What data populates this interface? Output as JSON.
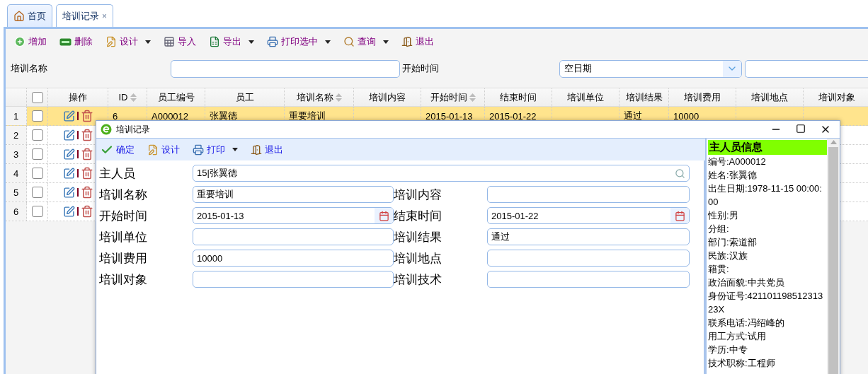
{
  "tabs": [
    {
      "label": "首页",
      "closable": false,
      "selected": false
    },
    {
      "label": "培训记录",
      "closable": true,
      "selected": true
    }
  ],
  "close_mark": "×",
  "toolbar": [
    {
      "label": "增加",
      "dropdown": false
    },
    {
      "label": "删除",
      "dropdown": false
    },
    {
      "label": "设计",
      "dropdown": true
    },
    {
      "label": "导入",
      "dropdown": false
    },
    {
      "label": "导出",
      "dropdown": true
    },
    {
      "label": "打印选中",
      "dropdown": true
    },
    {
      "label": "查询",
      "dropdown": true
    },
    {
      "label": "退出",
      "dropdown": false
    }
  ],
  "filter": {
    "label": "培训名称",
    "date_label": "开始时间",
    "date_value": "空日期"
  },
  "grid": {
    "all_checked": false,
    "columns": [
      {
        "label": "操作",
        "sortable": false
      },
      {
        "label": "ID",
        "sortable": true
      },
      {
        "label": "员工编号",
        "sortable": false
      },
      {
        "label": "员工",
        "sortable": false
      },
      {
        "label": "培训名称",
        "sortable": true
      },
      {
        "label": "培训内容",
        "sortable": false
      },
      {
        "label": "开始时间",
        "sortable": true
      },
      {
        "label": "结束时间",
        "sortable": false
      },
      {
        "label": "培训单位",
        "sortable": false
      },
      {
        "label": "培训结果",
        "sortable": false
      },
      {
        "label": "培训费用",
        "sortable": false
      },
      {
        "label": "培训地点",
        "sortable": false
      },
      {
        "label": "培训对象",
        "sortable": false
      }
    ],
    "rows": [
      {
        "number": "1",
        "selected": true,
        "checked": false,
        "cells": [
          "6",
          "A000012",
          "张翼德",
          "重要培训",
          null,
          "2015-01-13",
          "2015-01-22",
          null,
          "通过",
          "10000",
          null,
          null
        ]
      },
      {
        "number": "2",
        "selected": false,
        "checked": false
      },
      {
        "number": "3",
        "selected": false,
        "checked": false
      },
      {
        "number": "4",
        "selected": false,
        "checked": false
      },
      {
        "number": "5",
        "selected": false,
        "checked": false
      },
      {
        "number": "6",
        "selected": false,
        "checked": false
      }
    ]
  },
  "dialog": {
    "title": "培训记录",
    "toolbar": [
      {
        "label": "确定",
        "dropdown": false
      },
      {
        "label": "设计",
        "dropdown": false
      },
      {
        "label": "打印",
        "dropdown": true
      },
      {
        "label": "退出",
        "dropdown": false
      }
    ],
    "fields": [
      {
        "label": "主人员",
        "value": "15|张翼德",
        "kind": "lookup"
      },
      {
        "label": "培训名称",
        "value": "重要培训",
        "kind": "text"
      },
      {
        "label": "培训内容",
        "kind": "text"
      },
      {
        "label": "开始时间",
        "value": "2015-01-13",
        "kind": "date"
      },
      {
        "label": "结束时间",
        "value": "2015-01-22",
        "kind": "date"
      },
      {
        "label": "培训单位",
        "kind": "text"
      },
      {
        "label": "培训结果",
        "value": "通过",
        "kind": "text"
      },
      {
        "label": "培训费用",
        "value": "10000",
        "kind": "text"
      },
      {
        "label": "培训地点",
        "kind": "text"
      },
      {
        "label": "培训对象",
        "kind": "text"
      },
      {
        "label": "培训技术",
        "kind": "text"
      }
    ],
    "info": {
      "title": "主人员信息",
      "lines": [
        "编号:A000012",
        "姓名:张翼德",
        "出生日期:1978-11-15 00:00:00",
        "性别:男",
        "分组:",
        "部门:索道部",
        "民族:汉族",
        "籍贯:",
        "政治面貌:中共党员",
        "身份证号:42110119851231323X",
        "联系电话:冯绍峰的",
        "用工方式:试用",
        "学历:中专",
        "技术职称:工程师"
      ]
    }
  }
}
